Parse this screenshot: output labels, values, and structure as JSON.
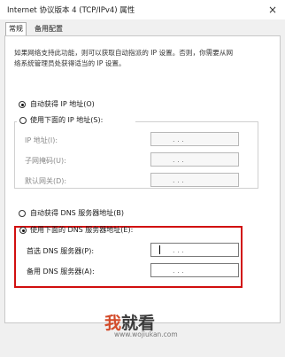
{
  "window": {
    "title": "Internet 协议版本 4 (TCP/IPv4) 属性",
    "close_label": "×"
  },
  "tabs": [
    {
      "label": "常规",
      "active": true
    },
    {
      "label": "备用配置",
      "active": false
    }
  ],
  "description": {
    "line1": "如果网络支持此功能，则可以获取自动指派的 IP 设置。否则，你需要从网",
    "line2": "络系统管理员处获得适当的 IP 设置。"
  },
  "ip_section": {
    "auto_label": "自动获得 IP 地址(O)",
    "manual_label": "使用下面的 IP 地址(S):",
    "selected": "auto",
    "fields": [
      {
        "label": "IP 地址(I):",
        "value": ".   .   ."
      },
      {
        "label": "子网掩码(U):",
        "value": ".   .   ."
      },
      {
        "label": "默认网关(D):",
        "value": ".   .   ."
      }
    ]
  },
  "dns_section": {
    "auto_label": "自动获得 DNS 服务器地址(B)",
    "manual_label": "使用下面的 DNS 服务器地址(E):",
    "selected": "manual",
    "fields": [
      {
        "label": "首选 DNS 服务器(P):",
        "value": ".   .   ."
      },
      {
        "label": "备用 DNS 服务器(A):",
        "value": ".   .   ."
      }
    ]
  },
  "watermark": {
    "part1": "我",
    "part2": "就看",
    "url": "www.wojiukan.com"
  },
  "colors": {
    "highlight": "#d10f0f",
    "watermark": "#d34b2a"
  }
}
